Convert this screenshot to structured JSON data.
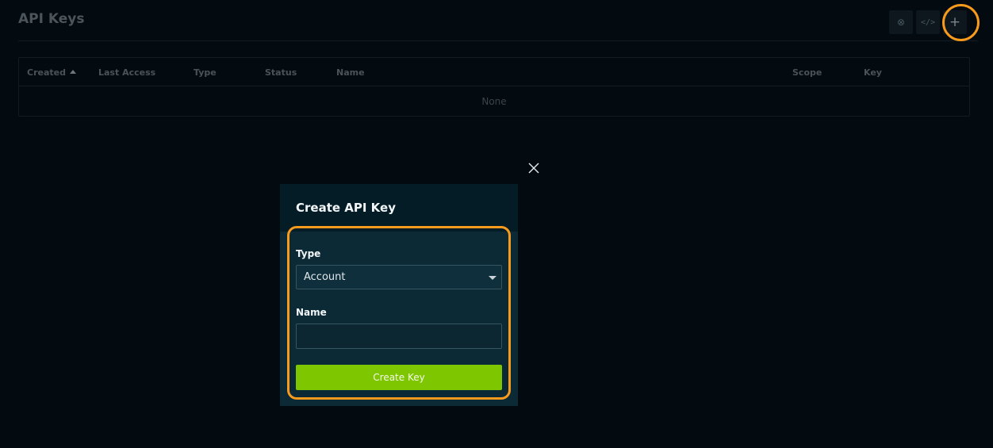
{
  "page": {
    "title": "API Keys",
    "actions": [
      {
        "icon": "help-icon",
        "glyph": "⊗"
      },
      {
        "icon": "code-icon",
        "glyph": "</>"
      },
      {
        "icon": "plus-icon",
        "glyph": "+"
      }
    ]
  },
  "table": {
    "columns": [
      "Created",
      "Last Access",
      "Type",
      "Status",
      "Name",
      "Scope",
      "Key"
    ],
    "empty_text": "None",
    "sort_column": "Created"
  },
  "modal": {
    "title": "Create API Key",
    "type_label": "Type",
    "type_value": "Account",
    "name_label": "Name",
    "name_value": "",
    "submit_label": "Create Key"
  },
  "colors": {
    "accent": "#7dc600",
    "highlight": "#f89a1c",
    "background": "#030b10",
    "modal_bg": "#0b2a36"
  }
}
